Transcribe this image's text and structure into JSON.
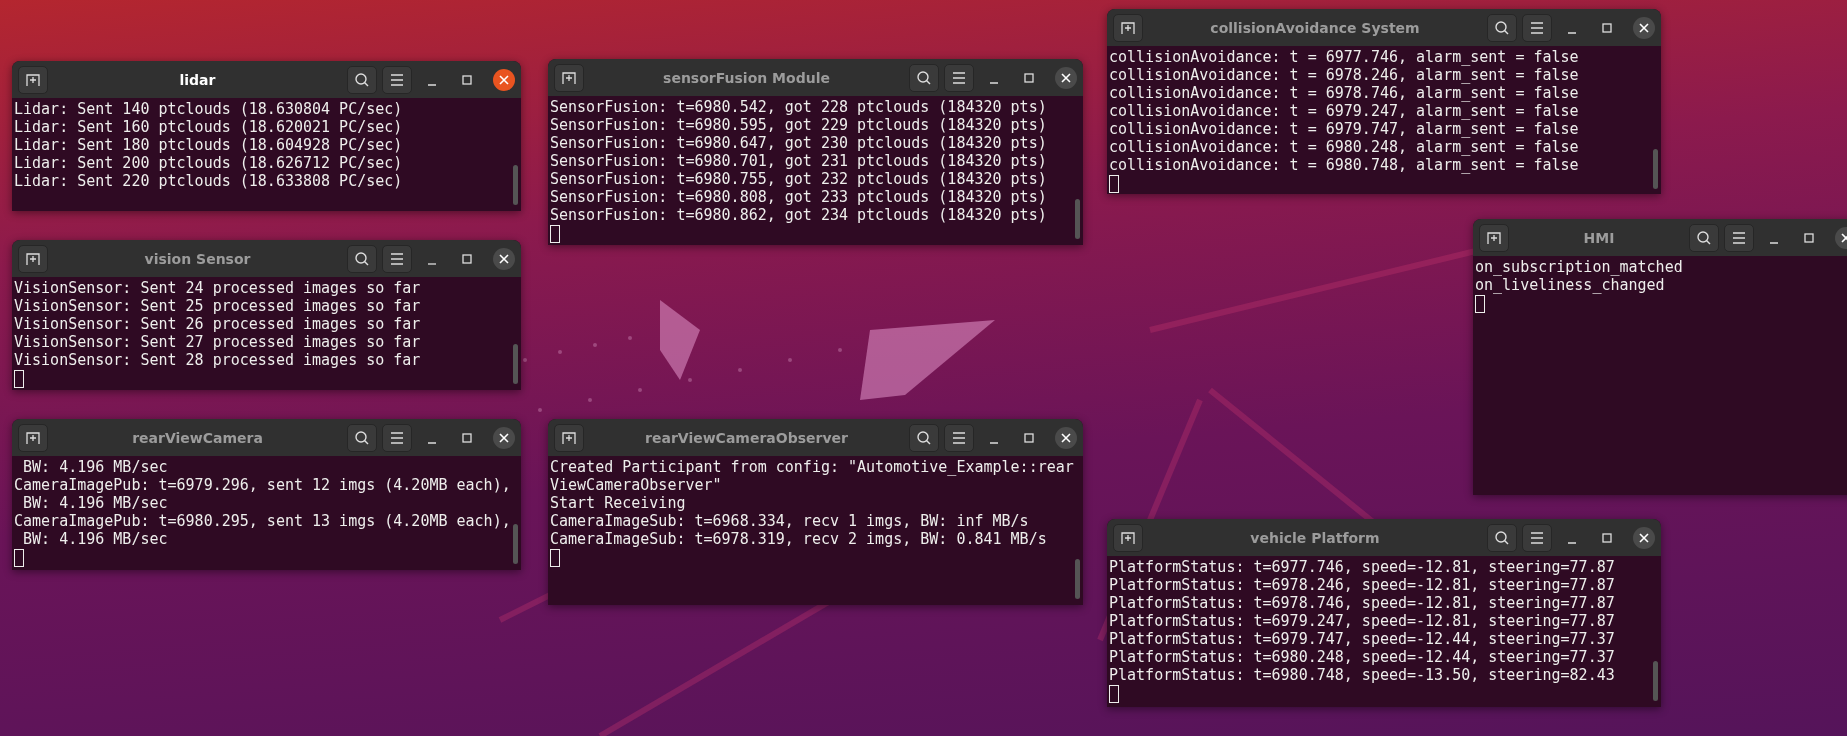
{
  "windows": [
    {
      "title": "lidar",
      "focused": true,
      "cursor": false,
      "lines": [
        "Lidar: Sent 140 ptclouds (18.630804 PC/sec)",
        "Lidar: Sent 160 ptclouds (18.620021 PC/sec)",
        "Lidar: Sent 180 ptclouds (18.604928 PC/sec)",
        "Lidar: Sent 200 ptclouds (18.626712 PC/sec)",
        "Lidar: Sent 220 ptclouds (18.633808 PC/sec)"
      ]
    },
    {
      "title": "sensorFusion Module",
      "focused": false,
      "cursor": true,
      "lines": [
        "SensorFusion: t=6980.542, got 228 ptclouds (184320 pts)",
        "SensorFusion: t=6980.595, got 229 ptclouds (184320 pts)",
        "SensorFusion: t=6980.647, got 230 ptclouds (184320 pts)",
        "SensorFusion: t=6980.701, got 231 ptclouds (184320 pts)",
        "SensorFusion: t=6980.755, got 232 ptclouds (184320 pts)",
        "SensorFusion: t=6980.808, got 233 ptclouds (184320 pts)",
        "SensorFusion: t=6980.862, got 234 ptclouds (184320 pts)"
      ]
    },
    {
      "title": "collisionAvoidance System",
      "focused": false,
      "cursor": true,
      "lines": [
        "collisionAvoidance: t = 6977.746, alarm_sent = false",
        "collisionAvoidance: t = 6978.246, alarm_sent = false",
        "collisionAvoidance: t = 6978.746, alarm_sent = false",
        "collisionAvoidance: t = 6979.247, alarm_sent = false",
        "collisionAvoidance: t = 6979.747, alarm_sent = false",
        "collisionAvoidance: t = 6980.248, alarm_sent = false",
        "collisionAvoidance: t = 6980.748, alarm_sent = false"
      ]
    },
    {
      "title": "HMI",
      "focused": false,
      "cursor": true,
      "lines": [
        "on_subscription_matched",
        "on_liveliness_changed"
      ]
    },
    {
      "title": "vision Sensor",
      "focused": false,
      "cursor": true,
      "lines": [
        "VisionSensor: Sent 24 processed images so far",
        "VisionSensor: Sent 25 processed images so far",
        "VisionSensor: Sent 26 processed images so far",
        "VisionSensor: Sent 27 processed images so far",
        "VisionSensor: Sent 28 processed images so far"
      ]
    },
    {
      "title": "rearViewCamera",
      "focused": false,
      "cursor": true,
      "lines": [
        " BW: 4.196 MB/sec",
        "CameraImagePub: t=6979.296, sent 12 imgs (4.20MB each),",
        " BW: 4.196 MB/sec",
        "CameraImagePub: t=6980.295, sent 13 imgs (4.20MB each),",
        " BW: 4.196 MB/sec"
      ]
    },
    {
      "title": "rearViewCameraObserver",
      "focused": false,
      "cursor": true,
      "lines": [
        "Created Participant from config: \"Automotive_Example::rear",
        "ViewCameraObserver\"",
        "Start Receiving",
        "CameraImageSub: t=6968.334, recv 1 imgs, BW: inf MB/s",
        "CameraImageSub: t=6978.319, recv 2 imgs, BW: 0.841 MB/s"
      ]
    },
    {
      "title": "vehicle Platform",
      "focused": false,
      "cursor": true,
      "lines": [
        "PlatformStatus: t=6977.746, speed=-12.81, steering=77.87",
        "PlatformStatus: t=6978.246, speed=-12.81, steering=77.87",
        "PlatformStatus: t=6978.746, speed=-12.81, steering=77.87",
        "PlatformStatus: t=6979.247, speed=-12.81, steering=77.87",
        "PlatformStatus: t=6979.747, speed=-12.44, steering=77.37",
        "PlatformStatus: t=6980.248, speed=-12.44, steering=77.37",
        "PlatformStatus: t=6980.748, speed=-13.50, steering=82.43"
      ]
    }
  ]
}
